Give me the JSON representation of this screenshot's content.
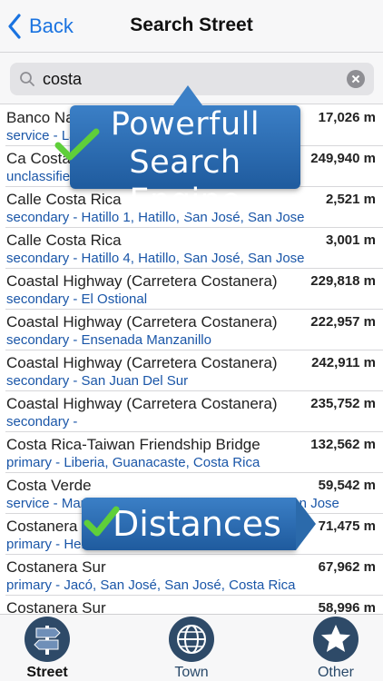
{
  "navbar": {
    "back_label": "Back",
    "title": "Search Street"
  },
  "search": {
    "value": "costa"
  },
  "results": [
    {
      "name": "Banco Nacional de Costa Rica",
      "distance": "17,026 m",
      "detail": "service - Las Pavas, San José, San José"
    },
    {
      "name": "Ca Costa Rica",
      "distance": "249,940 m",
      "detail": "unclassified"
    },
    {
      "name": "Calle Costa Rica",
      "distance": "2,521 m",
      "detail": "secondary - Hatillo 1, Hatillo, San José, San Jose"
    },
    {
      "name": "Calle Costa Rica",
      "distance": "3,001 m",
      "detail": "secondary - Hatillo 4, Hatillo, San José, San Jose"
    },
    {
      "name": "Coastal Highway (Carretera Costanera)",
      "distance": "229,818 m",
      "detail": "secondary - El Ostional"
    },
    {
      "name": "Coastal Highway (Carretera Costanera)",
      "distance": "222,957 m",
      "detail": "secondary - Ensenada Manzanillo"
    },
    {
      "name": "Coastal Highway (Carretera Costanera)",
      "distance": "242,911 m",
      "detail": "secondary - San Juan Del Sur"
    },
    {
      "name": "Coastal Highway (Carretera Costanera)",
      "distance": "235,752 m",
      "detail": "secondary -"
    },
    {
      "name": "Costa Rica-Taiwan Friendship Bridge",
      "distance": "132,562 m",
      "detail": "primary - Liberia, Guanacaste, Costa Rica"
    },
    {
      "name": "Costa Verde",
      "distance": "59,542 m",
      "detail": "service - Manuel Antonio, Quepos, San José, San Jose"
    },
    {
      "name": "Costanera Sur",
      "distance": "71,475 m",
      "detail": "primary - Herradura, Jacó, San José, San José"
    },
    {
      "name": "Costanera Sur",
      "distance": "67,962 m",
      "detail": "primary - Jacó, San José, San José, Costa Rica"
    },
    {
      "name": "Costanera Sur",
      "distance": "58,996 m",
      "detail": ""
    }
  ],
  "callouts": {
    "search_engine": [
      "Powerfull",
      "Search Engine"
    ],
    "distances": "Distances"
  },
  "tabs": [
    {
      "label": "Street",
      "icon": "signpost-icon",
      "active": true
    },
    {
      "label": "Town",
      "icon": "globe-icon",
      "active": false
    },
    {
      "label": "Other",
      "icon": "star-icon",
      "active": false
    }
  ],
  "colors": {
    "accent": "#1a73e0",
    "detail_text": "#1a56a8",
    "callout": "#2b6aab",
    "check": "#5fcf3a",
    "tab_icon": "#2e4a68"
  }
}
